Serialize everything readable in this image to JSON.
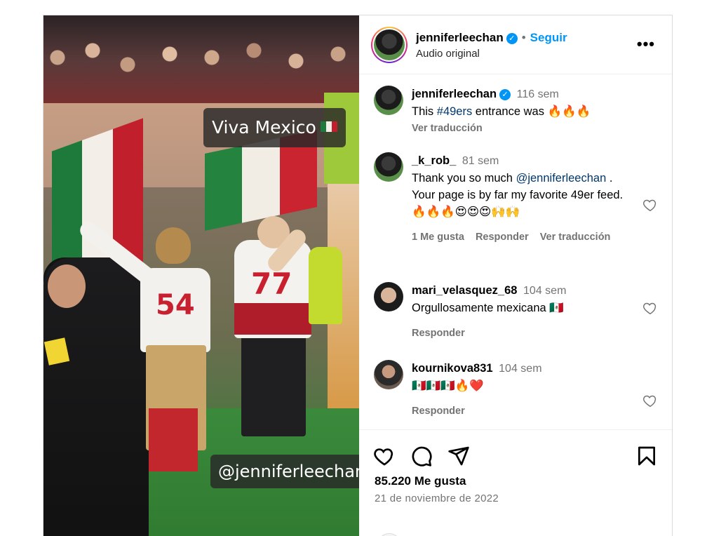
{
  "video": {
    "overlay_top": "Viva Mexico",
    "overlay_bottom": "@jenniferleechan",
    "jersey_a": "54",
    "jersey_b": "77"
  },
  "post": {
    "author": "jenniferleechan",
    "follow_label": "Seguir",
    "audio_label": "Audio original",
    "more_label": "•••",
    "likes_text": "85.220 Me gusta",
    "date_text": "21 de noviembre de 2022"
  },
  "caption": {
    "user": "jenniferleechan",
    "time": "116 sem",
    "text_before": "This ",
    "hashtag": "#49ers",
    "text_after": " entrance was 🔥🔥🔥",
    "translate_label": "Ver traducción"
  },
  "comments": [
    {
      "user": "_k_rob_",
      "time": "81 sem",
      "text_before": "Thank you so much ",
      "mention": "@jenniferleechan",
      "text_after": " . Your page is by far my favorite 49er feed. 🔥🔥🔥😍😍😍🙌🙌",
      "likes_label": "1 Me gusta",
      "reply_label": "Responder",
      "translate_label": "Ver traducción"
    },
    {
      "user": "mari_velasquez_68",
      "time": "104 sem",
      "text": "Orgullosamente mexicana 🇲🇽",
      "reply_label": "Responder"
    },
    {
      "user": "kournikova831",
      "time": "104 sem",
      "text": "🇲🇽🇲🇽🇲🇽🔥❤️",
      "reply_label": "Responder"
    }
  ],
  "icons": {
    "like": "heart-icon",
    "comment": "comment-icon",
    "share": "share-icon",
    "save": "bookmark-icon",
    "verified": "verified-badge-icon",
    "more": "more-options-icon"
  },
  "colors": {
    "accent": "#0095f6",
    "hashtag": "#00376b",
    "muted": "#737373",
    "border": "#dbdbdb"
  }
}
